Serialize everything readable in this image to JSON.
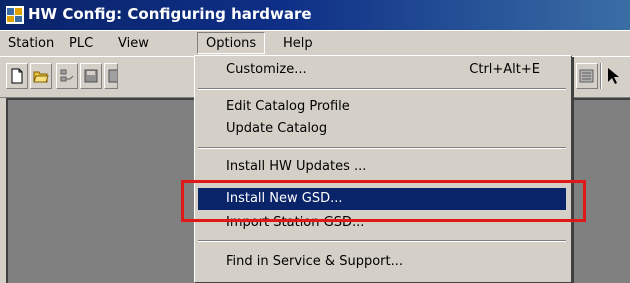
{
  "window": {
    "title": "HW Config: Configuring hardware",
    "title_bar_color": "#0a246a"
  },
  "menubar": {
    "items": [
      {
        "label": "Station"
      },
      {
        "label": "PLC"
      },
      {
        "label": "View"
      },
      {
        "label": "Options",
        "active": true
      },
      {
        "label": "Help"
      }
    ]
  },
  "toolbar": {
    "buttons": [
      "new-icon",
      "open-icon",
      "network-icon",
      "save-icon",
      "download-icon"
    ],
    "right_buttons": [
      "catalog-icon",
      "pointer-icon"
    ]
  },
  "options_menu": {
    "items": [
      {
        "label": "Customize...",
        "shortcut": "Ctrl+Alt+E"
      },
      {
        "label": "Edit Catalog Profile"
      },
      {
        "label": "Update Catalog"
      },
      {
        "label": "Install HW Updates ..."
      },
      {
        "label": "Install New GSD...",
        "selected": true
      },
      {
        "label": "Import Station GSD..."
      },
      {
        "label": "Find in Service & Support..."
      }
    ],
    "selection_color": "#0a246a"
  },
  "annotation": {
    "highlight_color": "#e01818",
    "target": "Install New GSD..."
  }
}
